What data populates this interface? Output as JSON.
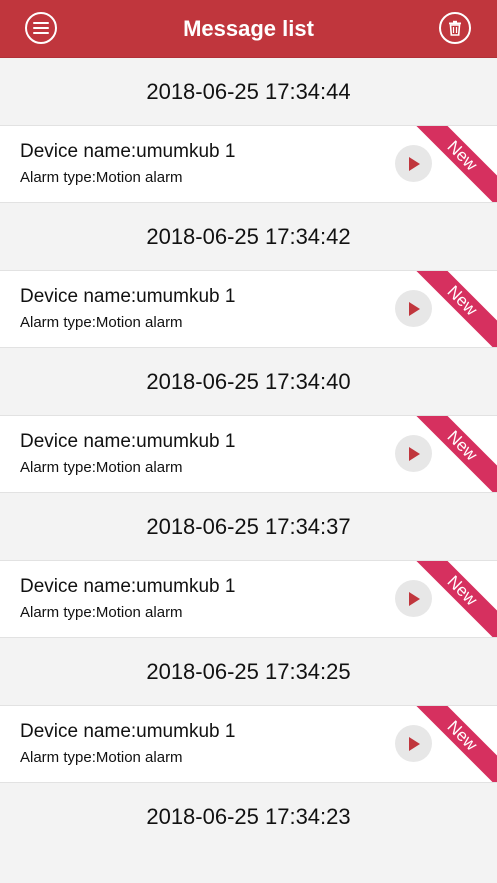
{
  "colors": {
    "brand": "#c0363d",
    "badge": "#d6305f",
    "play_icon": "#c0363d"
  },
  "header": {
    "title": "Message list",
    "left_icon": "menu-icon",
    "right_icon": "trash-icon"
  },
  "messages": [
    {
      "timestamp": "2018-06-25 17:34:44",
      "device_name": "Device name:umumkub 1",
      "alarm_type": "Alarm type:Motion alarm",
      "badge": "New"
    },
    {
      "timestamp": "2018-06-25 17:34:42",
      "device_name": "Device name:umumkub 1",
      "alarm_type": "Alarm type:Motion alarm",
      "badge": "New"
    },
    {
      "timestamp": "2018-06-25 17:34:40",
      "device_name": "Device name:umumkub 1",
      "alarm_type": "Alarm type:Motion alarm",
      "badge": "New"
    },
    {
      "timestamp": "2018-06-25 17:34:37",
      "device_name": "Device name:umumkub 1",
      "alarm_type": "Alarm type:Motion alarm",
      "badge": "New"
    },
    {
      "timestamp": "2018-06-25 17:34:25",
      "device_name": "Device name:umumkub 1",
      "alarm_type": "Alarm type:Motion alarm",
      "badge": "New"
    },
    {
      "timestamp": "2018-06-25 17:34:23"
    }
  ]
}
